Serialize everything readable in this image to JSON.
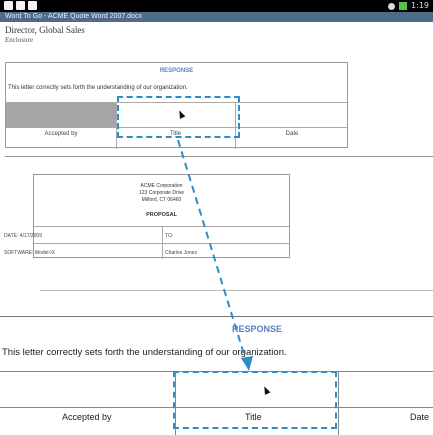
{
  "status_bar": {
    "time": "1:19",
    "icons_left": [
      "usb-icon",
      "sd-card-icon",
      "download-icon"
    ],
    "icons_right": [
      "wifi-icon",
      "battery-icon"
    ]
  },
  "window": {
    "title": "Word To Go - ACME Quote Word 2007.docx"
  },
  "document": {
    "line1": "Director, Global Sales",
    "line2": "Enclosure",
    "response_small": {
      "header": "RESPONSE",
      "sentence": "This letter correctly sets forth the understanding of our organization.",
      "labels": [
        "Accepted by",
        "Title",
        "Date"
      ]
    },
    "proposal": {
      "company": "ACME Corporation",
      "address1": "123 Corporate Drive",
      "address2": "Milford, CT 06460",
      "title": "PROPOSAL",
      "date_label": "DATE: 4/17/2009",
      "to_label": "TO:",
      "software_label": "SOFTWARE: Model-IX",
      "to_name": "Charles Jones"
    },
    "response_big": {
      "header": "RESPONSE",
      "sentence": "This letter correctly sets forth the understanding of our organization.",
      "labels": [
        "Accepted by",
        "Title",
        "Date"
      ]
    }
  },
  "colors": {
    "accent": "#2b8ec9",
    "header_blue": "#5b7fc1",
    "title_bar": "#4e6b8a",
    "gray_cell": "#a6a4a7"
  }
}
